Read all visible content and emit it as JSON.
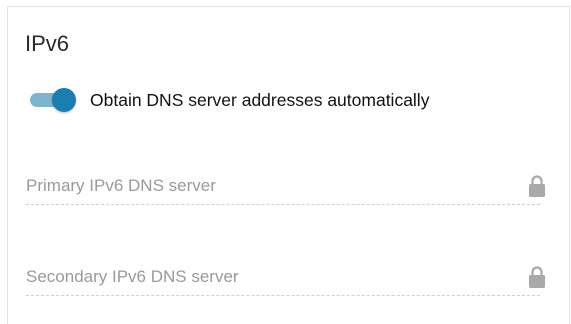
{
  "section": {
    "title": "IPv6"
  },
  "dns_toggle": {
    "label": "Obtain DNS server addresses automatically",
    "enabled": true
  },
  "fields": {
    "primary": {
      "placeholder": "Primary IPv6 DNS server",
      "value": "",
      "icon": "lock-icon",
      "locked": true
    },
    "secondary": {
      "placeholder": "Secondary IPv6 DNS server",
      "value": "",
      "icon": "lock-icon",
      "locked": true
    }
  },
  "colors": {
    "toggle_track": "#7fb3ce",
    "toggle_knob": "#1c7db0",
    "lock_icon": "#a9a9a9"
  }
}
